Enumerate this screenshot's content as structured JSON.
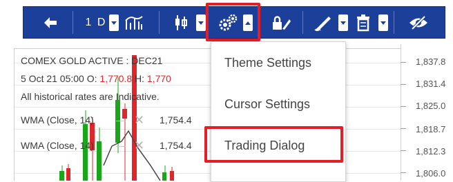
{
  "toolbar": {
    "interval_label": "1 D",
    "buttons": [
      "back-arrow",
      "interval",
      "indicators",
      "chart-type",
      "settings",
      "lock-drawing",
      "draw-tools",
      "delete",
      "hide"
    ]
  },
  "menu": {
    "items": [
      "Theme Settings",
      "Cursor Settings",
      "Trading Dialog"
    ]
  },
  "chart_info": {
    "title": "COMEX GOLD ACTIVE : DEC21",
    "ohlc_prefix": "5 Oct 21 05:00  O:",
    "open": "1,770.8",
    "high_label": "H:",
    "high": "1,770",
    "disclaimer": "All historical rates are Indicative.",
    "wma1_label": "WMA  (Close, 14)",
    "wma1_value": "1,754.4",
    "wma2_label": "WMA  (Close, 14)",
    "wma2_value": "1,754.4"
  },
  "yaxis": [
    "1,837.8",
    "1,831.4",
    "1,825.0",
    "1,818.7",
    "1,812.3",
    "1,806.0"
  ],
  "colors": {
    "toolbar": "#1c3f99",
    "highlight": "#e41e26",
    "bull": "#1aa51a",
    "bear": "#e0262b"
  }
}
